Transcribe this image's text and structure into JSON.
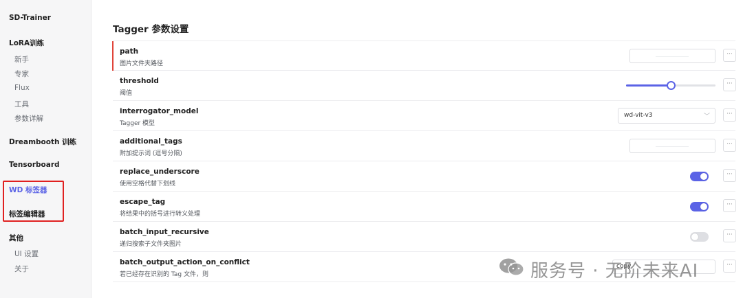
{
  "sidebar": {
    "title": "SD-Trainer",
    "lora_heading": "LoRA训练",
    "lora_items": [
      "新手",
      "专家",
      "Flux",
      "工具",
      "参数详解"
    ],
    "dreambooth_heading": "Dreambooth 训练",
    "tensorboard_heading": "Tensorboard",
    "wd_tagger_heading": "WD 标签器",
    "tag_editor_heading": "标签编辑器",
    "other_heading": "其他",
    "other_items": [
      "UI 设置",
      "关于"
    ]
  },
  "main": {
    "title": "Tagger 参数设置",
    "more_label": "···",
    "rows": [
      {
        "name": "path",
        "desc": "图片文件夹路径",
        "control": "text",
        "value": ""
      },
      {
        "name": "threshold",
        "desc": "阈值",
        "control": "slider",
        "value_fraction": 0.5
      },
      {
        "name": "interrogator_model",
        "desc": "Tagger 模型",
        "control": "select",
        "value": "wd-vit-v3",
        "chevron": "﹀"
      },
      {
        "name": "additional_tags",
        "desc": "附加提示词 (逗号分隔)",
        "control": "text",
        "value": ""
      },
      {
        "name": "replace_underscore",
        "desc": "使用空格代替下划线",
        "control": "toggle",
        "on": true
      },
      {
        "name": "escape_tag",
        "desc": "将结果中的括号进行转义处理",
        "control": "toggle",
        "on": true
      },
      {
        "name": "batch_input_recursive",
        "desc": "递归搜索子文件夹图片",
        "control": "toggle",
        "on": false
      },
      {
        "name": "batch_output_action_on_conflict",
        "desc": "若已经存在识别的 Tag 文件，则",
        "control": "select-partial",
        "value": "copy"
      }
    ]
  },
  "watermark": {
    "text": "服务号 · 无阶未来AI"
  },
  "colors": {
    "accent": "#5b63e6",
    "highlight_box": "#e02020",
    "focus_bar": "#e0453a"
  }
}
